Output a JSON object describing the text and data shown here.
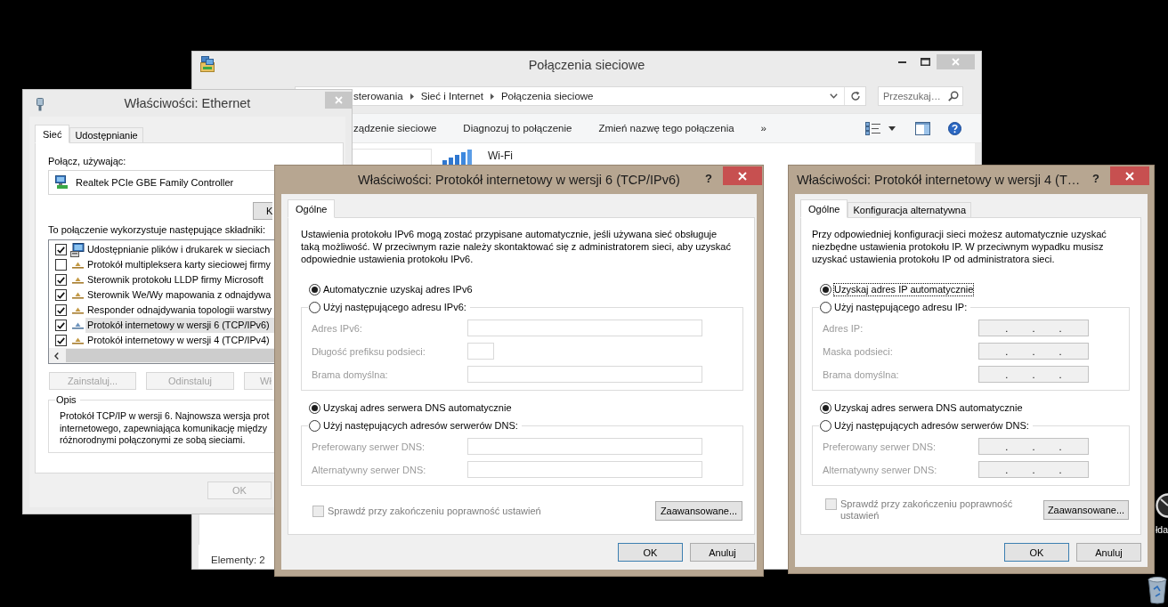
{
  "explorer": {
    "title": "Połączenia sieciowe",
    "active": false,
    "breadcrumb": [
      "sterowania",
      "Sieć i Internet",
      "Połączenia sieciowe"
    ],
    "search": {
      "placeholder": "Przeszukaj…"
    },
    "toolbar": [
      "ządzenie sieciowe",
      "Diagnozuj to połączenie",
      "Zmień nazwę tego połączenia",
      "»"
    ],
    "items": [
      {
        "name": "Wi-Fi"
      }
    ],
    "status_bar": "Elementy: 2"
  },
  "ethernet_dialog": {
    "title": "Właściwości: Ethernet",
    "active": false,
    "tabs": [
      {
        "label": "Sieć",
        "selected": true
      },
      {
        "label": "Udostępnianie",
        "selected": false
      }
    ],
    "connect_using": "Połącz, używając:",
    "adapter": "Realtek PCIe GBE Family Controller",
    "configure_button": "K",
    "components_label": "To połączenie wykorzystuje następujące składniki:",
    "components": [
      {
        "kind": "service",
        "label": "Udostępnianie plików i drukarek w sieciach",
        "checked": true,
        "selected": false
      },
      {
        "kind": "protocol",
        "label": "Protokół multipleksera karty sieciowej firmy",
        "checked": false,
        "selected": false
      },
      {
        "kind": "protocol",
        "label": "Sterownik protokołu LLDP firmy Microsoft",
        "checked": true,
        "selected": false
      },
      {
        "kind": "protocol",
        "label": "Sterownik We/Wy mapowania z odnajdywa",
        "checked": true,
        "selected": false
      },
      {
        "kind": "protocol",
        "label": "Responder odnajdywania topologii warstwy",
        "checked": true,
        "selected": false
      },
      {
        "kind": "protocol",
        "label": "Protokół internetowy w wersji 6 (TCP/IPv6)",
        "checked": true,
        "selected": true
      },
      {
        "kind": "protocol",
        "label": "Protokół internetowy w wersji 4 (TCP/IPv4)",
        "checked": true,
        "selected": false
      }
    ],
    "buttons": [
      {
        "label": "Zainstaluj...",
        "disabled": true
      },
      {
        "label": "Odinstaluj",
        "disabled": true
      },
      {
        "label": "Wł",
        "disabled": true
      }
    ],
    "description": {
      "title": "Opis",
      "text": "Protokół TCP/IP w wersji 6. Najnowsza wersja prot\ninternetowego, zapewniająca komunikację między\nróżnorodnymi połączonymi ze sobą sieciami."
    },
    "ok_button": {
      "label": "OK",
      "disabled": true
    }
  },
  "ipv6_dialog": {
    "title": "Właściwości: Protokół internetowy w wersji 6 (TCP/IPv6)",
    "active": true,
    "help": "?",
    "tabs": [
      {
        "label": "Ogólne",
        "selected": true
      }
    ],
    "intro": "Ustawienia protokołu IPv6 mogą zostać przypisane automatycznie, jeśli używana sieć obsługuje\ntaką możliwość. W przeciwnym razie należy skontaktować się z administratorem sieci, aby uzyskać\nodpowiednie ustawienia protokołu IPv6.",
    "address": {
      "options": [
        {
          "label": "Automatycznie uzyskaj adres IPv6",
          "selected": true
        },
        {
          "label": "Użyj następującego adresu IPv6:",
          "selected": false
        }
      ],
      "fields": [
        {
          "label": "Adres IPv6:",
          "kind": "wide"
        },
        {
          "label": "Długość prefiksu podsieci:",
          "kind": "narrow"
        },
        {
          "label": "Brama domyślna:",
          "kind": "wide"
        }
      ]
    },
    "dns": {
      "options": [
        {
          "label": "Uzyskaj adres serwera DNS automatycznie",
          "selected": true
        },
        {
          "label": "Użyj następujących adresów serwerów DNS:",
          "selected": false
        }
      ],
      "fields": [
        {
          "label": "Preferowany serwer DNS:",
          "kind": "wide"
        },
        {
          "label": "Alternatywny serwer DNS:",
          "kind": "wide"
        }
      ]
    },
    "validate": {
      "label": "Sprawdź przy zakończeniu poprawność ustawień",
      "checked": false,
      "disabled": true
    },
    "advanced_button": "Zaawansowane...",
    "buttons": [
      {
        "label": "OK",
        "default": true
      },
      {
        "label": "Anuluj",
        "default": false
      }
    ]
  },
  "ipv4_dialog": {
    "title": "Właściwości: Protokół internetowy w wersji 4 (T…",
    "active": true,
    "help": "?",
    "tabs": [
      {
        "label": "Ogólne",
        "selected": true
      },
      {
        "label": "Konfiguracja alternatywna",
        "selected": false
      }
    ],
    "intro": "Przy odpowiedniej konfiguracji sieci możesz automatycznie uzyskać\nniezbędne ustawienia protokołu IP. W przeciwnym wypadku musisz\nuzyskać ustawienia protokołu IP od administratora sieci.",
    "address": {
      "options": [
        {
          "label": "Uzyskaj adres IP automatycznie",
          "selected": true,
          "focused": true
        },
        {
          "label": "Użyj następującego adresu IP:",
          "selected": false,
          "focused": false
        }
      ],
      "fields": [
        {
          "label": "Adres IP:",
          "kind": "ip",
          "value": ". . ."
        },
        {
          "label": "Maska podsieci:",
          "kind": "ip",
          "value": ". . ."
        },
        {
          "label": "Brama domyślna:",
          "kind": "ip",
          "value": ". . ."
        }
      ]
    },
    "dns": {
      "options": [
        {
          "label": "Uzyskaj adres serwera DNS automatycznie",
          "selected": true
        },
        {
          "label": "Użyj następujących adresów serwerów DNS:",
          "selected": false
        }
      ],
      "fields": [
        {
          "label": "Preferowany serwer DNS:",
          "kind": "ip",
          "value": ". . ."
        },
        {
          "label": "Alternatywny serwer DNS:",
          "kind": "ip",
          "value": ". . ."
        }
      ]
    },
    "validate": {
      "label": "Sprawdź przy zakończeniu poprawność ustawień",
      "checked": false,
      "disabled": true
    },
    "advanced_button": "Zaawansowane...",
    "buttons": [
      {
        "label": "OK",
        "default": true
      },
      {
        "label": "Anuluj",
        "default": false
      }
    ]
  },
  "desktop_icons": [
    {
      "kind": "clock",
      "label": "łda"
    },
    {
      "kind": "trash"
    }
  ]
}
